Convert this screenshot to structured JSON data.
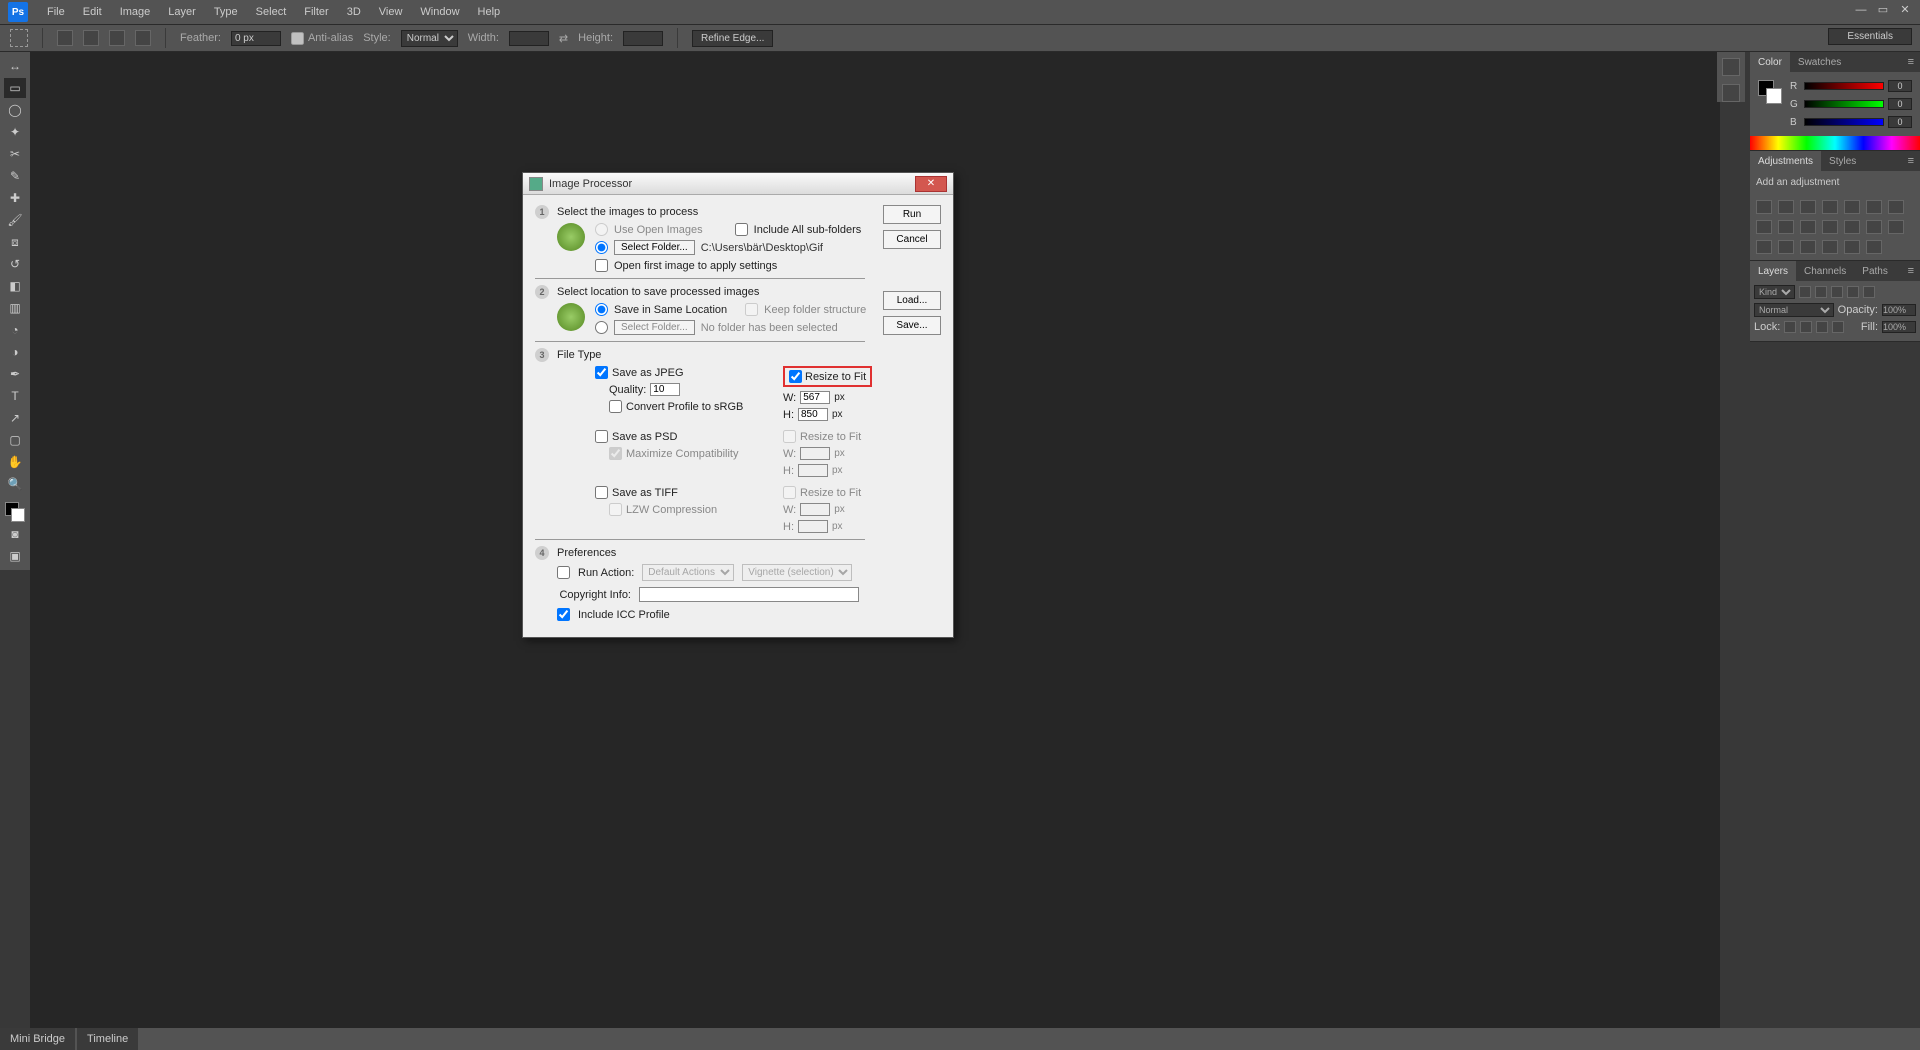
{
  "menubar": {
    "items": [
      "File",
      "Edit",
      "Image",
      "Layer",
      "Type",
      "Select",
      "Filter",
      "3D",
      "View",
      "Window",
      "Help"
    ]
  },
  "optbar": {
    "feather_label": "Feather:",
    "feather_value": "0 px",
    "antialias": "Anti-alias",
    "style_label": "Style:",
    "style_value": "Normal",
    "width_label": "Width:",
    "height_label": "Height:",
    "refine": "Refine Edge...",
    "workspace": "Essentials"
  },
  "panels": {
    "color_tab": "Color",
    "swatches_tab": "Swatches",
    "r_label": "R",
    "g_label": "G",
    "b_label": "B",
    "r_val": "0",
    "g_val": "0",
    "b_val": "0",
    "adjustments_tab": "Adjustments",
    "styles_tab": "Styles",
    "add_adjustment": "Add an adjustment",
    "layers_tab": "Layers",
    "channels_tab": "Channels",
    "paths_tab": "Paths",
    "kind": "Kind",
    "mode": "Normal",
    "opacity_label": "Opacity:",
    "opacity_val": "100%",
    "lock_label": "Lock:",
    "fill_label": "Fill:",
    "fill_val": "100%"
  },
  "status": {
    "mini_bridge": "Mini Bridge",
    "timeline": "Timeline"
  },
  "dialog": {
    "title": "Image Processor",
    "buttons": {
      "run": "Run",
      "cancel": "Cancel",
      "load": "Load...",
      "save": "Save..."
    },
    "s1": {
      "title": "Select the images to process",
      "use_open": "Use Open Images",
      "include_sub": "Include All sub-folders",
      "select_folder": "Select Folder...",
      "path": "C:\\Users\\bär\\Desktop\\Gif",
      "open_first": "Open first image to apply settings"
    },
    "s2": {
      "title": "Select location to save processed images",
      "same_loc": "Save in Same Location",
      "keep_folder": "Keep folder structure",
      "select_folder": "Select Folder...",
      "no_folder": "No folder has been selected"
    },
    "s3": {
      "title": "File Type",
      "save_jpeg": "Save as JPEG",
      "resize_fit": "Resize to Fit",
      "quality_label": "Quality:",
      "quality_val": "10",
      "w_label": "W:",
      "h_label": "H:",
      "jpeg_w": "567",
      "jpeg_h": "850",
      "px": "px",
      "convert_srgb": "Convert Profile to sRGB",
      "save_psd": "Save as PSD",
      "max_compat": "Maximize Compatibility",
      "save_tiff": "Save as TIFF",
      "lzw": "LZW Compression"
    },
    "s4": {
      "title": "Preferences",
      "run_action": "Run Action:",
      "action_set": "Default Actions",
      "action": "Vignette (selection)",
      "copyright_label": "Copyright Info:",
      "copyright_val": "",
      "include_icc": "Include ICC Profile"
    }
  }
}
